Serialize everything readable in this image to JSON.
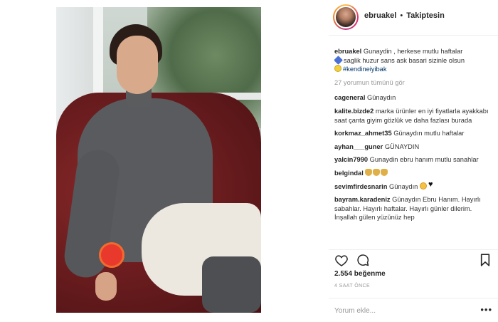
{
  "header": {
    "username": "ebruakel",
    "separator": "•",
    "follow_status": "Takiptesin"
  },
  "caption": {
    "username": "ebruakel",
    "line1": "Gunaydin , herkese mutlu haftalar",
    "line2": "saglik huzur sans ask basari sizinle olsun",
    "hashtag": "#kendineiyibak"
  },
  "view_all_comments": "27 yorumun tümünü gör",
  "comments": [
    {
      "user": "cageneral",
      "text": "Günaydın"
    },
    {
      "user": "kalite.bizde2",
      "text": "marka ürünler en iyi fiyatlarla ayakkabı saat çanta giyim gözlük ve daha fazlası burada"
    },
    {
      "user": "korkmaz_ahmet35",
      "text": "Günaydın mutlu haftalar"
    },
    {
      "user": "ayhan___guner",
      "text": "GÜNAYDIN"
    },
    {
      "user": "yalcin7990",
      "text": "Gunaydin ebru hanım mutlu sanahlar"
    },
    {
      "user": "belgindal",
      "text": ""
    },
    {
      "user": "sevimfirdesnarin",
      "text": "Günaydın"
    },
    {
      "user": "bayram.karadeniz",
      "text": "Günaydın Ebru Hanım. Hayırlı sabahlar. Hayırlı haftalar. Hayırlı günler dilerim. İnşallah gülen yüzünüz hep"
    }
  ],
  "likes": "2.554 beğenme",
  "time_ago": "4 SAAT ÖNCE",
  "composer": {
    "placeholder": "Yorum ekle..."
  },
  "icons": {
    "like": "heart-outline-icon",
    "comment": "speech-bubble-icon",
    "save": "bookmark-icon",
    "more": "more-dots-icon"
  },
  "colors": {
    "text": "#262626",
    "muted": "#999999",
    "hashtag": "#003569",
    "border": "#efefef"
  }
}
